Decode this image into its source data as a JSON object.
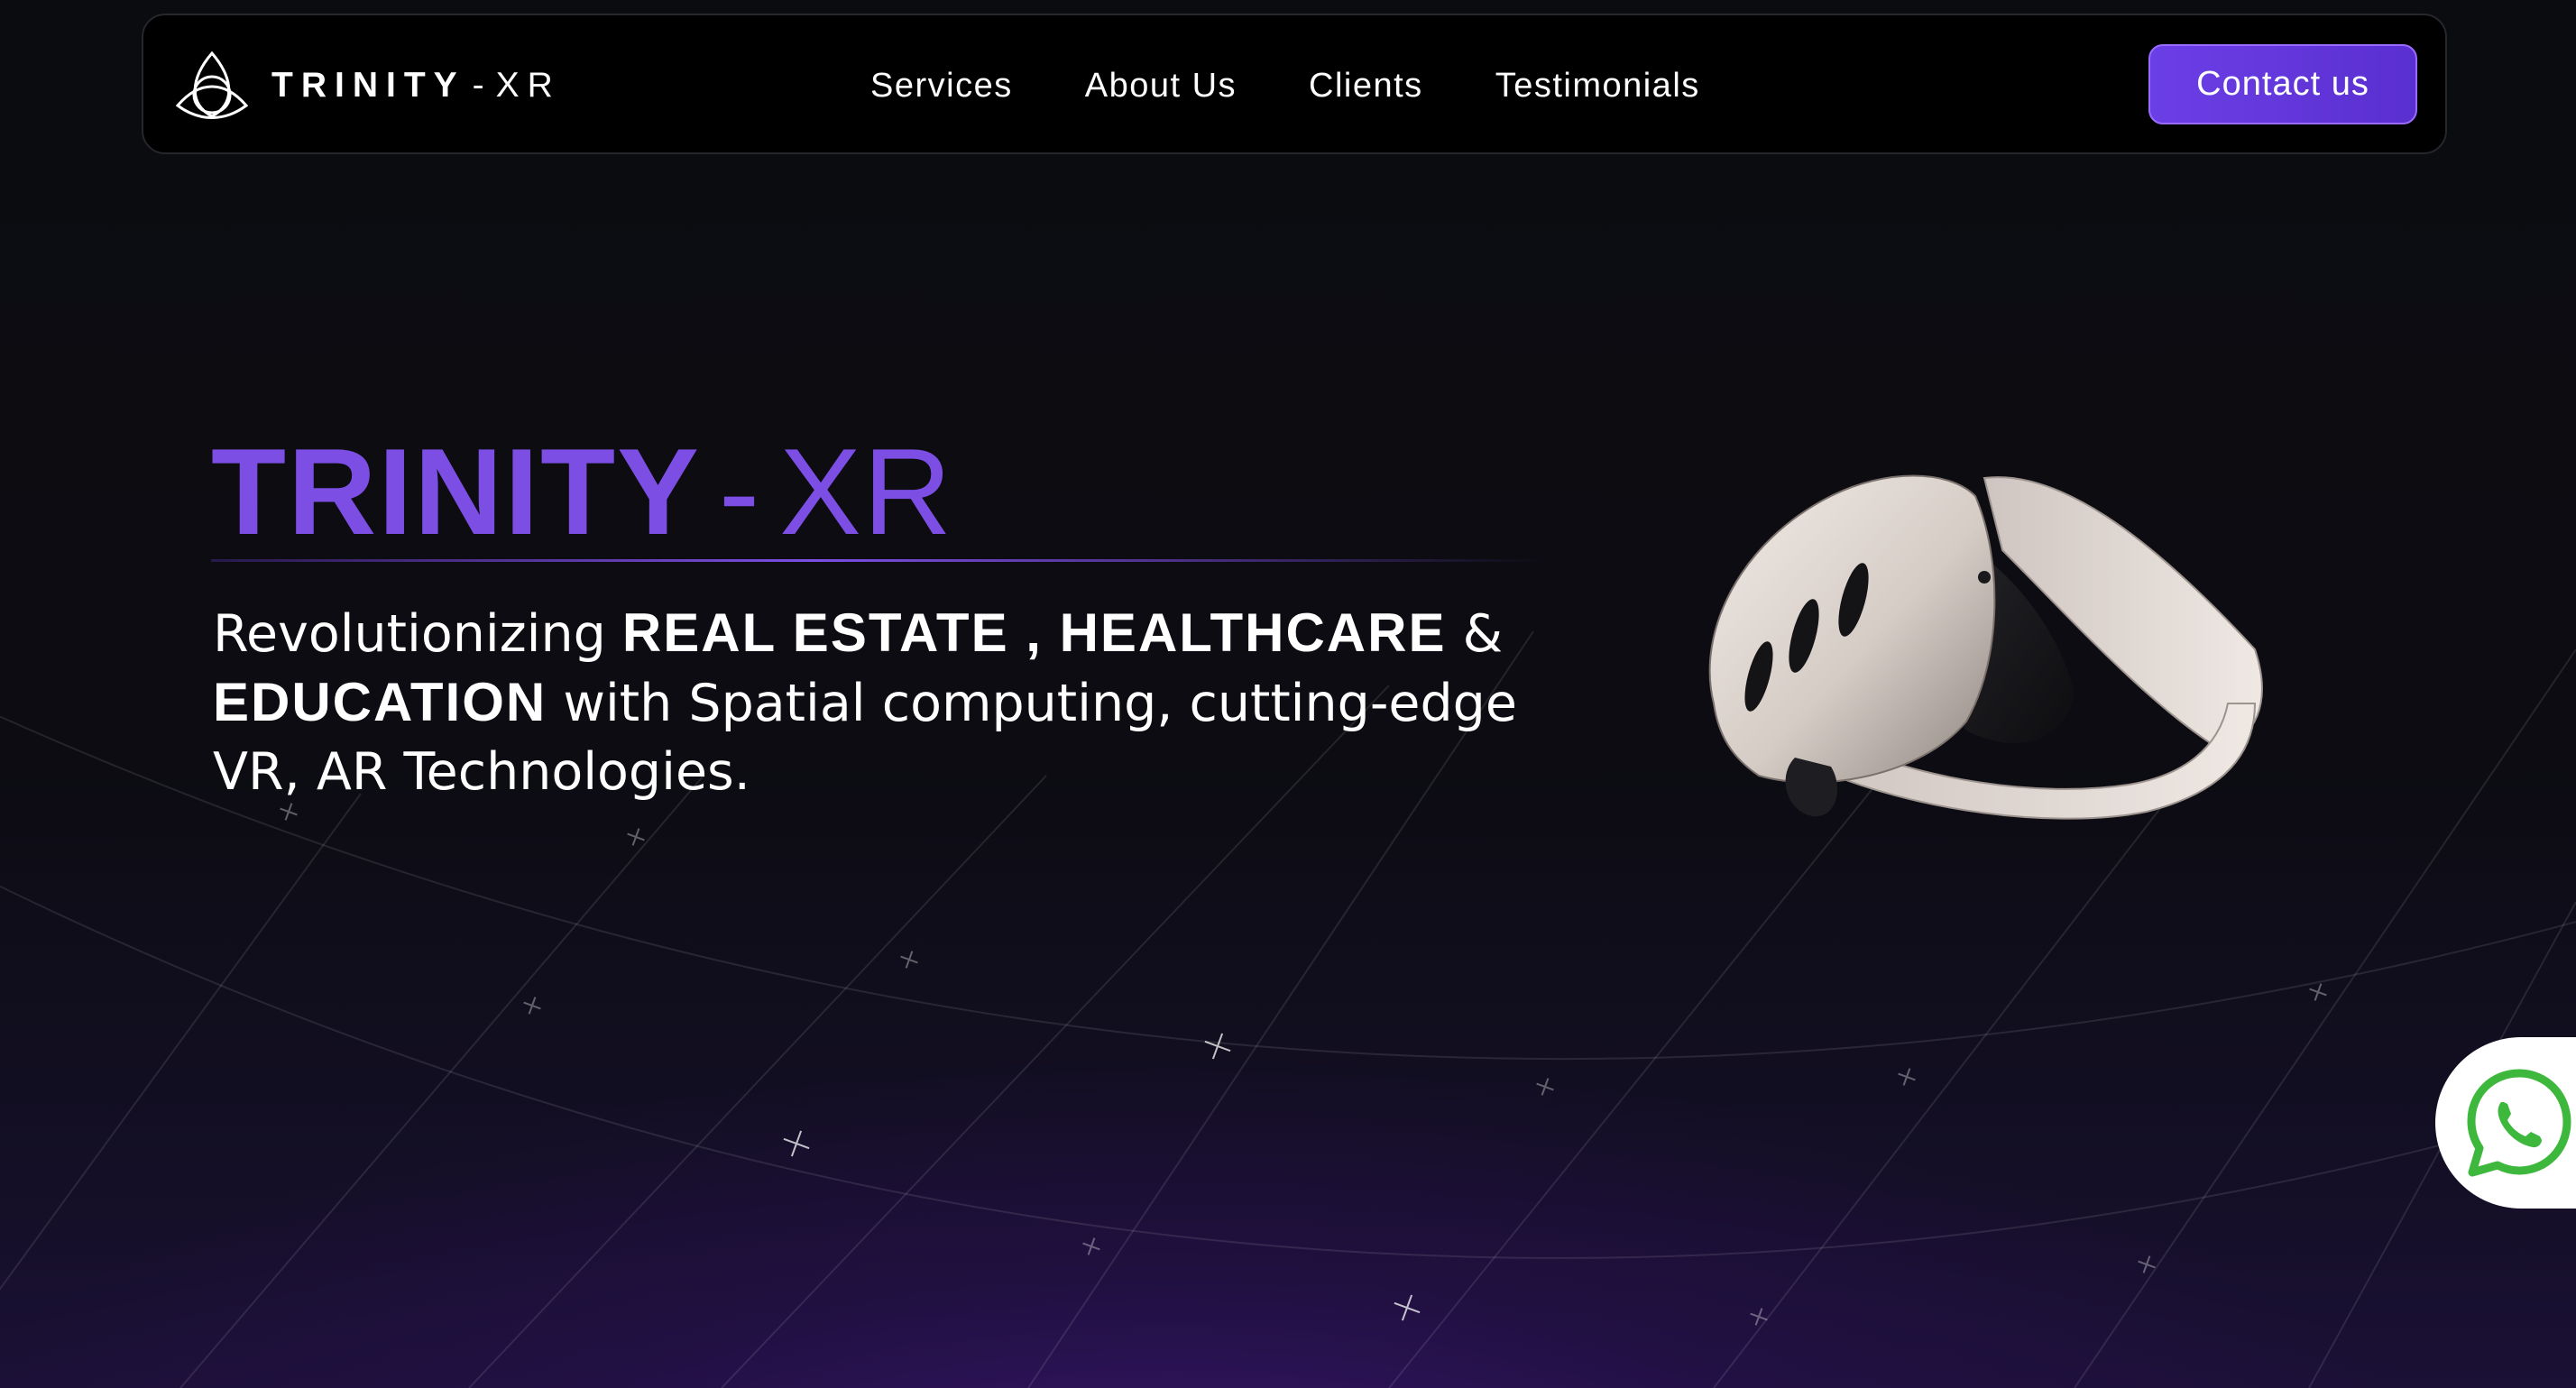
{
  "brand": {
    "name": "TRINITY",
    "separator": "-",
    "suffix": "XR",
    "logo_icon": "triquetra-icon",
    "accent_color": "#7c4ee4"
  },
  "nav": {
    "links": [
      {
        "label": "Services"
      },
      {
        "label": "About Us"
      },
      {
        "label": "Clients"
      },
      {
        "label": "Testimonials"
      }
    ],
    "contact_label": "Contact us"
  },
  "hero": {
    "title_main": "TRINITY",
    "title_dash": "-",
    "title_xr": "XR",
    "subtitle": {
      "part1": "Revolutionizing ",
      "bold1": "REAL ESTATE , HEALTHCARE",
      "part2": " & ",
      "bold2": "EDUCATION",
      "part3": " with Spatial computing, cutting-edge VR, AR Technologies."
    },
    "illustration": "vr-headset-image"
  },
  "floating": {
    "whatsapp_icon": "whatsapp-icon",
    "whatsapp_color": "#3db83d"
  }
}
